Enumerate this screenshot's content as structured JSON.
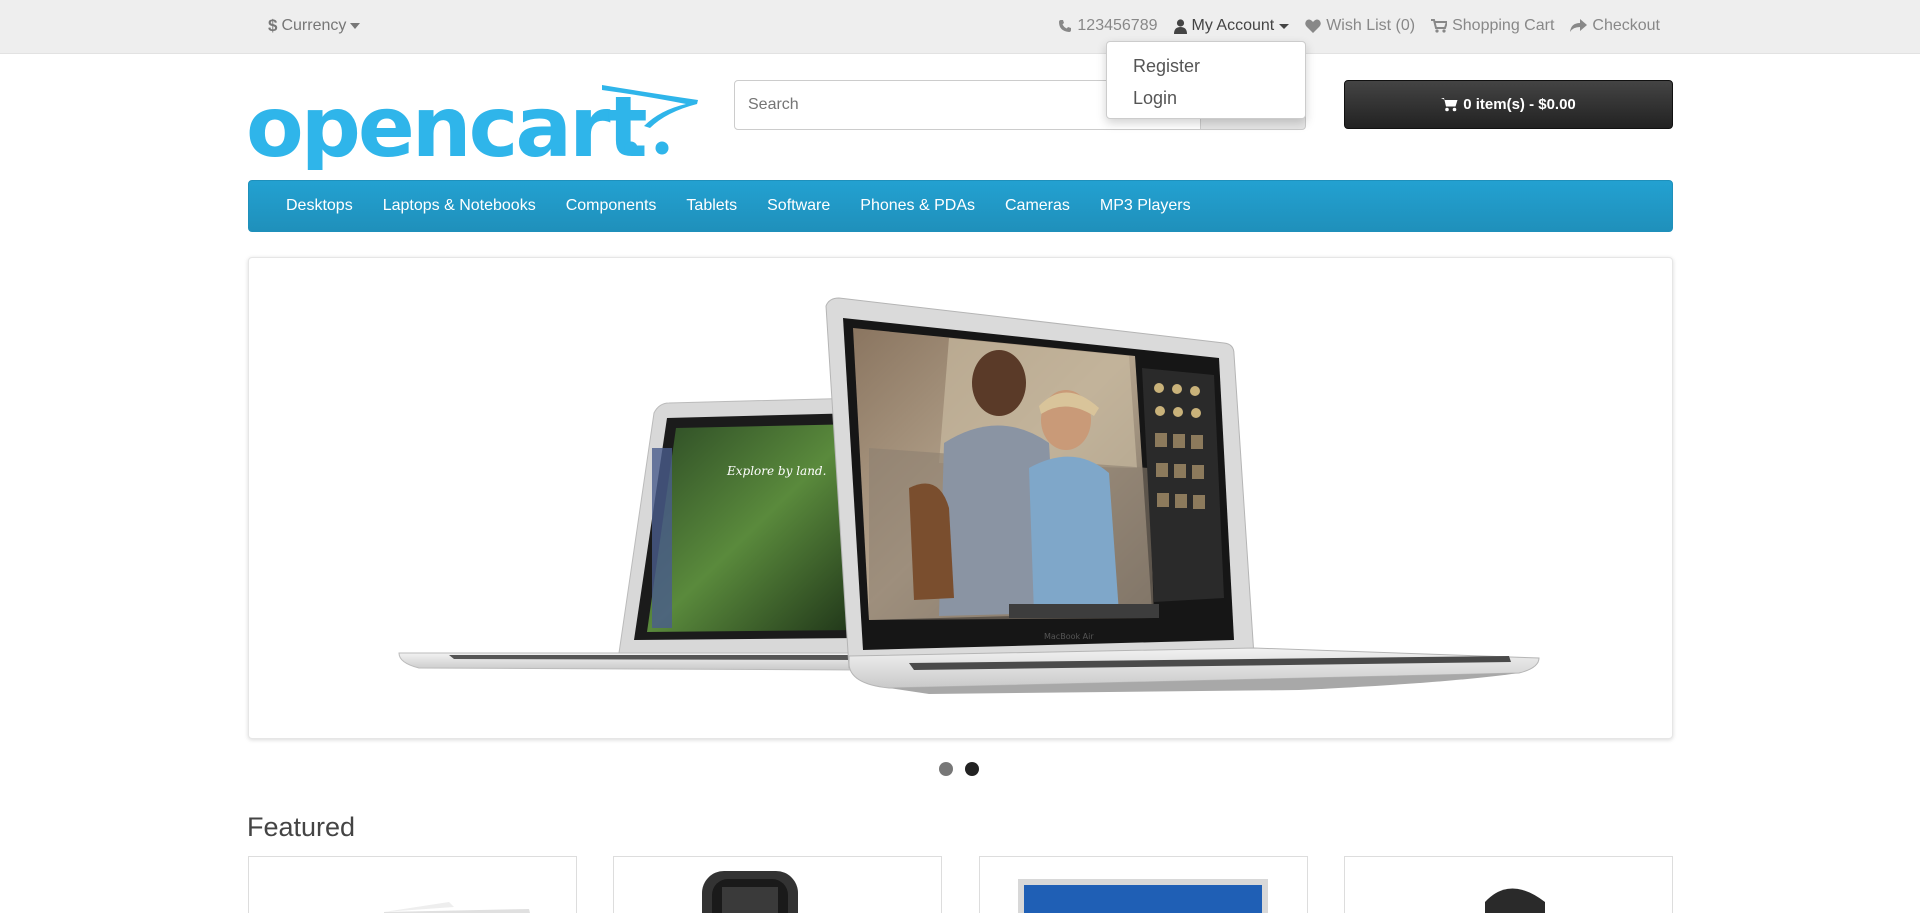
{
  "topbar": {
    "currency_label": "Currency",
    "currency_symbol": "$",
    "phone": "123456789",
    "my_account": "My Account",
    "wish_list": "Wish List (0)",
    "shopping_cart": "Shopping Cart",
    "checkout": "Checkout"
  },
  "account_dropdown": {
    "items": [
      {
        "label": "Register"
      },
      {
        "label": "Login"
      }
    ]
  },
  "header": {
    "logo_text": "opencart",
    "search_placeholder": "Search",
    "cart_summary": "0 item(s) - $0.00"
  },
  "menu": {
    "items": [
      {
        "label": "Desktops"
      },
      {
        "label": "Laptops & Notebooks"
      },
      {
        "label": "Components"
      },
      {
        "label": "Tablets"
      },
      {
        "label": "Software"
      },
      {
        "label": "Phones & PDAs"
      },
      {
        "label": "Cameras"
      },
      {
        "label": "MP3 Players"
      }
    ]
  },
  "slideshow": {
    "slide_count": 2,
    "active_slide": 2,
    "back_laptop_text": "Explore by land.",
    "laptop_label": "MacBook Air"
  },
  "featured": {
    "title": "Featured"
  },
  "colors": {
    "brand_blue": "#23a1d1",
    "logo_blue": "#2fb5ea",
    "topbar_bg": "#eeeeee",
    "cart_button": "#333333"
  }
}
